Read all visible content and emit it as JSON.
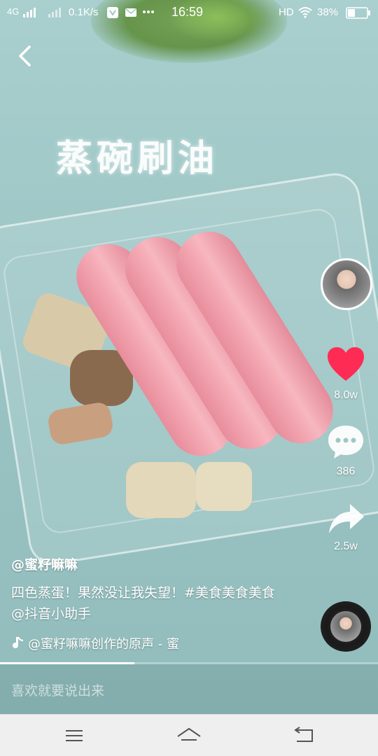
{
  "status_bar": {
    "network": "4G",
    "speed": "0.1K/s",
    "time": "16:59",
    "hd": "HD",
    "battery": "38%"
  },
  "video": {
    "overlay_text": "蒸碗刷油"
  },
  "sidebar": {
    "like_count": "8.0w",
    "comment_count": "386",
    "share_count": "2.5w"
  },
  "post": {
    "author": "@蜜籽嘛嘛",
    "caption": "四色蒸蛋！果然没让我失望！#美食美食美食 @抖音小助手",
    "music": "@蜜籽嘛嘛创作的原声 - 蜜"
  },
  "playback": {
    "progress": 0.355
  },
  "comment": {
    "placeholder": "喜欢就要说出来"
  },
  "colors": {
    "like": "#fe2c55",
    "video_bg": "#9ec7c6"
  }
}
